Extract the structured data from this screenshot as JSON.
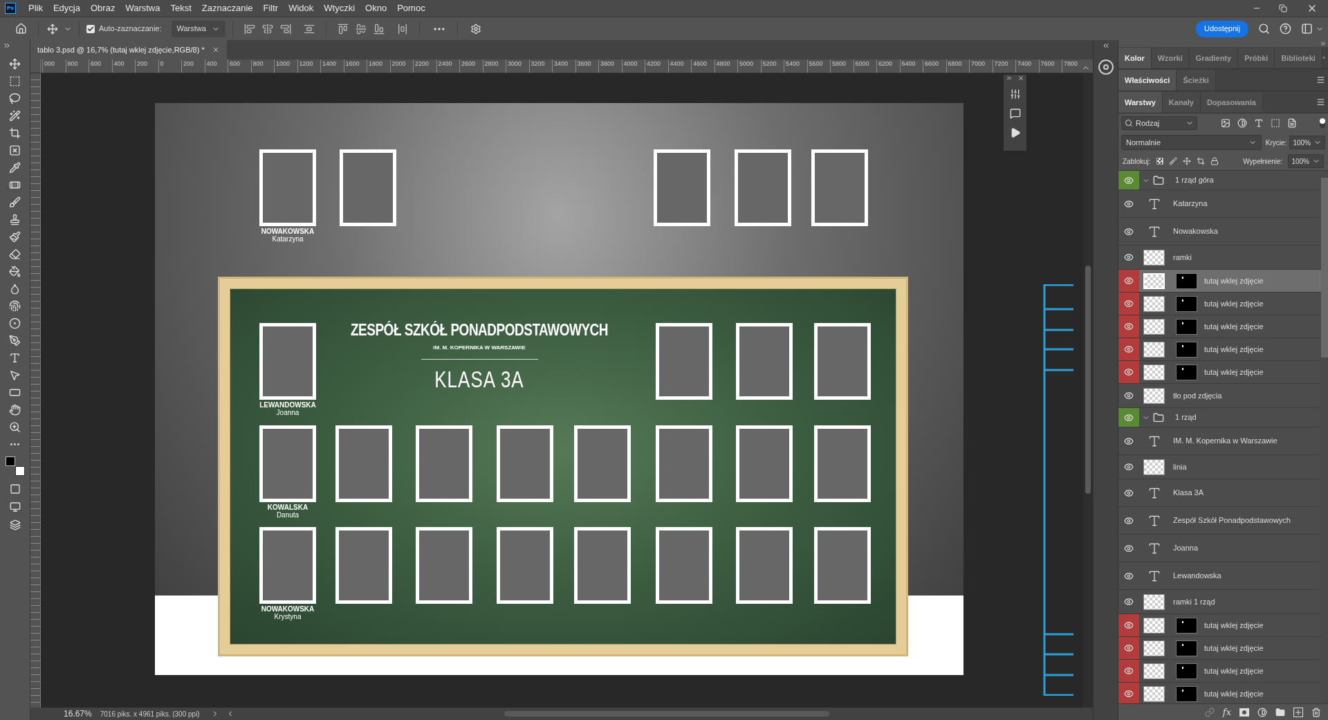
{
  "app_logo": "Ps",
  "menu": [
    "Plik",
    "Edycja",
    "Obraz",
    "Warstwa",
    "Tekst",
    "Zaznaczanie",
    "Filtr",
    "Widok",
    "Wtyczki",
    "Okno",
    "Pomoc"
  ],
  "options_bar": {
    "auto_select_label": "Auto-zaznaczanie:",
    "auto_select_checked": true,
    "target": "Warstwa",
    "share_button": "Udostępnij"
  },
  "document_tab": {
    "title": "tablo 3.psd @ 16,7% (tutaj wklej zdjęcie,RGB/8) *"
  },
  "ruler_labels": [
    "000",
    "800",
    "600",
    "400",
    "200",
    "0",
    "200",
    "400",
    "600",
    "800",
    "1000",
    "1200",
    "1400",
    "1600",
    "1800",
    "2000",
    "2200",
    "2400",
    "2600",
    "2800",
    "3000",
    "3200",
    "3400",
    "3600",
    "3800",
    "4000",
    "4200",
    "4400",
    "4600",
    "4800",
    "5000",
    "5200",
    "5400",
    "5600",
    "5800",
    "6000",
    "6200",
    "6400",
    "6600",
    "6800",
    "7000",
    "7200",
    "7400",
    "7600",
    "7800"
  ],
  "document": {
    "top_student": {
      "surname": "NOWAKOWSKA",
      "first_name": "Katarzyna"
    },
    "board": {
      "title": "ZESPÓŁ SZKÓŁ PONADPODSTAWOWYCH",
      "subtitle": "IM. M. KOPERNIKA W WARSZAWIE",
      "class_name": "KLASA 3A",
      "students": [
        {
          "surname": "LEWANDOWSKA",
          "first_name": "Joanna"
        },
        {
          "surname": "KOWALSKA",
          "first_name": "Danuta"
        },
        {
          "surname": "NOWAKOWSKA",
          "first_name": "Krystyna"
        }
      ]
    }
  },
  "panel_groups": [
    {
      "tabs": [
        {
          "label": "Kolor",
          "selected": true
        },
        {
          "label": "Wzorki",
          "selected": false
        },
        {
          "label": "Gradienty",
          "selected": false
        },
        {
          "label": "Próbki",
          "selected": false
        },
        {
          "label": "Biblioteki",
          "selected": false
        }
      ]
    },
    {
      "tabs": [
        {
          "label": "Właściwości",
          "selected": true
        },
        {
          "label": "Ścieżki",
          "selected": false
        }
      ]
    },
    {
      "tabs": [
        {
          "label": "Warstwy",
          "selected": true
        },
        {
          "label": "Kanały",
          "selected": false
        },
        {
          "label": "Dopasowania",
          "selected": false
        }
      ]
    }
  ],
  "layers_panel": {
    "filter": "Rodzaj",
    "blend_mode": "Normalnie",
    "opacity_label": "Krycie:",
    "opacity": "100%",
    "lock_label": "Zablokuj:",
    "fill_label": "Wypełnienie:",
    "fill": "100%",
    "fx_button": "fx",
    "layers": [
      {
        "kind": "group",
        "name": "1 rząd góra",
        "color": "#5b8a35",
        "expanded": true,
        "selected": false,
        "children": [
          {
            "kind": "text",
            "name": "Katarzyna",
            "selected": false
          },
          {
            "kind": "text",
            "name": "Nowakowska",
            "selected": false
          },
          {
            "kind": "pixel",
            "name": "ramki",
            "selected": false
          },
          {
            "kind": "masked",
            "name": "tutaj wklej zdjęcie",
            "color": "#b23b3b",
            "selected": true
          },
          {
            "kind": "masked",
            "name": "tutaj wklej zdjęcie",
            "color": "#b23b3b",
            "selected": false
          },
          {
            "kind": "masked",
            "name": "tutaj wklej zdjęcie",
            "color": "#b23b3b",
            "selected": false
          },
          {
            "kind": "masked",
            "name": "tutaj wklej zdjęcie",
            "color": "#b23b3b",
            "selected": false
          },
          {
            "kind": "masked",
            "name": "tutaj wklej zdjęcie",
            "color": "#b23b3b",
            "selected": false
          },
          {
            "kind": "pixel",
            "name": "tło pod zdjęcia",
            "selected": false
          }
        ]
      },
      {
        "kind": "group",
        "name": "1 rząd",
        "color": "#5b8a35",
        "expanded": true,
        "selected": false,
        "children": [
          {
            "kind": "text",
            "name": "IM. M. Kopernika w Warszawie",
            "selected": false
          },
          {
            "kind": "pixel",
            "name": "linia",
            "selected": false
          },
          {
            "kind": "text",
            "name": "Klasa 3A",
            "selected": false
          },
          {
            "kind": "text",
            "name": "Zespół Szkół Ponadpodstawowych",
            "selected": false
          },
          {
            "kind": "text",
            "name": "Joanna",
            "selected": false
          },
          {
            "kind": "text",
            "name": "Lewandowska",
            "selected": false
          },
          {
            "kind": "pixel",
            "name": "ramki 1 rząd",
            "selected": false
          },
          {
            "kind": "masked",
            "name": "tutaj wklej zdjęcie",
            "color": "#b23b3b",
            "selected": false
          },
          {
            "kind": "masked",
            "name": "tutaj wklej zdjęcie",
            "color": "#b23b3b",
            "selected": false
          },
          {
            "kind": "masked",
            "name": "tutaj wklej zdjęcie",
            "color": "#b23b3b",
            "selected": false
          },
          {
            "kind": "masked",
            "name": "tutaj wklej zdjęcie",
            "color": "#b23b3b",
            "selected": false
          }
        ]
      }
    ]
  },
  "status_bar": {
    "zoom": "16.67%",
    "info": "7016 piks. x 4961 piks. (300 ppi)"
  }
}
